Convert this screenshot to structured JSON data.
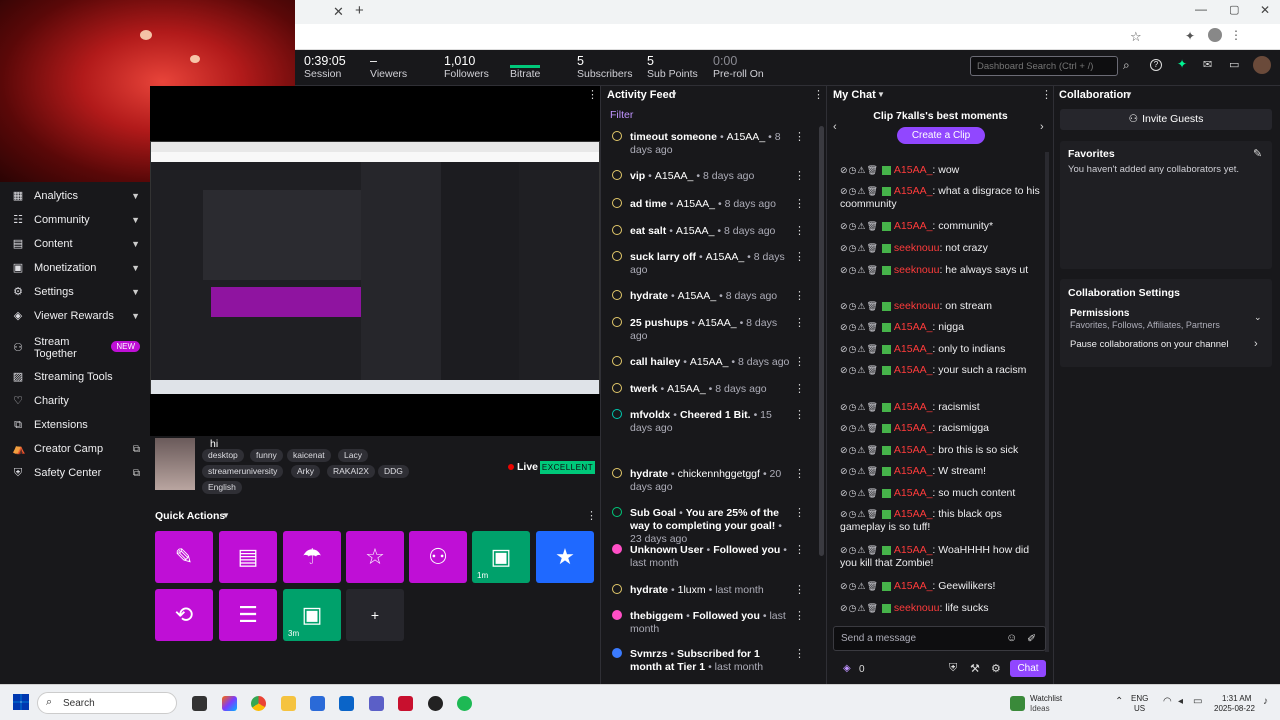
{
  "stats": [
    {
      "value": "0:39:05",
      "label": "Session"
    },
    {
      "value": "–",
      "label": "Viewers"
    },
    {
      "value": "1,010",
      "label": "Followers"
    },
    {
      "value": "",
      "label": "Bitrate"
    },
    {
      "value": "5",
      "label": "Subscribers"
    },
    {
      "value": "5",
      "label": "Sub Points"
    },
    {
      "value": "0:00",
      "label": "Pre-roll On"
    }
  ],
  "search": {
    "placeholder": "Dashboard Search (Ctrl + /)"
  },
  "sidebar": {
    "items": [
      {
        "label": "Analytics",
        "icon": "analytics-icon"
      },
      {
        "label": "Community",
        "icon": "community-icon"
      },
      {
        "label": "Content",
        "icon": "content-icon"
      },
      {
        "label": "Monetization",
        "icon": "monetization-icon"
      },
      {
        "label": "Settings",
        "icon": "settings-icon"
      },
      {
        "label": "Viewer Rewards",
        "icon": "rewards-icon"
      },
      {
        "label": "Stream Together",
        "icon": "stream-together-icon",
        "badge": "NEW"
      },
      {
        "label": "Streaming Tools",
        "icon": "tools-icon"
      },
      {
        "label": "Charity",
        "icon": "charity-icon"
      },
      {
        "label": "Extensions",
        "icon": "extensions-icon"
      },
      {
        "label": "Creator Camp",
        "icon": "camp-icon"
      },
      {
        "label": "Safety Center",
        "icon": "safety-icon"
      }
    ]
  },
  "stream_info": {
    "title": "hi",
    "tags": [
      "desktop",
      "funny",
      "kaicenat",
      "Lacy",
      "streameruniversity",
      "Arky",
      "RAKAI2X",
      "DDG",
      "English"
    ],
    "live_label": "Live",
    "health": "EXCELLENT"
  },
  "quick_actions": {
    "title": "Quick Actions",
    "labels": [
      "1m",
      "3m"
    ],
    "add": "+"
  },
  "activity": {
    "title": "Activity Feed",
    "filter": "Filter",
    "items": [
      {
        "name": "timeout someone",
        "sep": "•",
        "user": "A15AA_",
        "time": "• 8 days ago"
      },
      {
        "name": "vip",
        "sep": "•",
        "user": "A15AA_",
        "time": "• 8 days ago"
      },
      {
        "name": "ad time",
        "sep": "•",
        "user": "A15AA_",
        "time": "• 8 days ago"
      },
      {
        "name": "eat salt",
        "sep": "•",
        "user": "A15AA_",
        "time": "• 8 days ago"
      },
      {
        "name": "suck larry off",
        "sep": "•",
        "user": "A15AA_",
        "time": "• 8 days ago"
      },
      {
        "name": "hydrate",
        "sep": "•",
        "user": "A15AA_",
        "time": "• 8 days ago"
      },
      {
        "name": "25 pushups",
        "sep": "•",
        "user": "A15AA_",
        "time": "• 8 days ago"
      },
      {
        "name": "call hailey",
        "sep": "•",
        "user": "A15AA_",
        "time": "• 8 days ago"
      },
      {
        "name": "twerk",
        "sep": "•",
        "user": "A15AA_",
        "time": "• 8 days ago"
      },
      {
        "name": "mfvoldx",
        "sep": "•",
        "user": "Cheered 1 Bit.",
        "time": "• 15 days ago"
      },
      {
        "name": "hydrate",
        "sep": "•",
        "user": "chickennhggetggf",
        "time": "• 20 days ago"
      },
      {
        "name": "Sub Goal",
        "sep": "•",
        "user": "You are 25% of the way to completing your goal!",
        "time": "• 23 days ago"
      },
      {
        "name": "Unknown User",
        "sep": "•",
        "user": "Followed you",
        "time": "• last month"
      },
      {
        "name": "hydrate",
        "sep": "•",
        "user": "1luxm",
        "time": "• last month"
      },
      {
        "name": "thebiggem",
        "sep": "•",
        "user": "Followed you",
        "time": "• last month"
      },
      {
        "name": "Svmrzs",
        "sep": "•",
        "user": "Subscribed for 1 month at Tier 1",
        "time": "• last month"
      }
    ]
  },
  "chat": {
    "title": "My Chat",
    "clip_title": "Clip 7kalls's best moments",
    "clip_button": "Create a Clip",
    "input_placeholder": "Send a message",
    "points": "0",
    "send": "Chat",
    "lines": [
      {
        "user": "A15AA_",
        "msg": ": wow"
      },
      {
        "user": "A15AA_",
        "msg": ": what a disgrace to his coommunity"
      },
      {
        "user": "A15AA_",
        "msg": ": community*"
      },
      {
        "user": "seeknouu",
        "msg": ": not crazy"
      },
      {
        "user": "seeknouu",
        "msg": ": he always says ut"
      },
      {
        "user": "seeknouu",
        "msg": ": on stream"
      },
      {
        "user": "A15AA_",
        "msg": ": nigga"
      },
      {
        "user": "A15AA_",
        "msg": ": only to indians"
      },
      {
        "user": "A15AA_",
        "msg": ": your such a racism"
      },
      {
        "user": "A15AA_",
        "msg": ": racismist"
      },
      {
        "user": "A15AA_",
        "msg": ": racismigga"
      },
      {
        "user": "A15AA_",
        "msg": ": bro this is so sick"
      },
      {
        "user": "A15AA_",
        "msg": ": W stream!"
      },
      {
        "user": "A15AA_",
        "msg": ": so much content"
      },
      {
        "user": "A15AA_",
        "msg": ": this black ops gameplay is so tuff!"
      },
      {
        "user": "A15AA_",
        "msg": ": WoaHHHH how did you kill that Zombie!"
      },
      {
        "user": "A15AA_",
        "msg": ": Geewilikers!"
      },
      {
        "user": "seeknouu",
        "msg": ": life sucks"
      }
    ]
  },
  "collab": {
    "title": "Collaboration",
    "invite": "Invite Guests",
    "favorites_title": "Favorites",
    "favorites_empty": "You haven't added any collaborators yet.",
    "settings_title": "Collaboration Settings",
    "permissions": "Permissions",
    "permissions_sub": "Favorites, Follows, Affiliates, Partners",
    "pause": "Pause collaborations on your channel"
  },
  "taskbar": {
    "search": "Search",
    "watchlist": "Watchlist",
    "watchlist_sub": "Ideas",
    "lang": "ENG",
    "region": "US",
    "time": "1:31 AM",
    "date": "2025-08-22"
  },
  "colors": {
    "accent": "#9147ff",
    "qa_purple": "#bf0fd6",
    "qa_green": "#00a16b",
    "qa_blue": "#1f69ff",
    "live_green": "#00f593"
  }
}
